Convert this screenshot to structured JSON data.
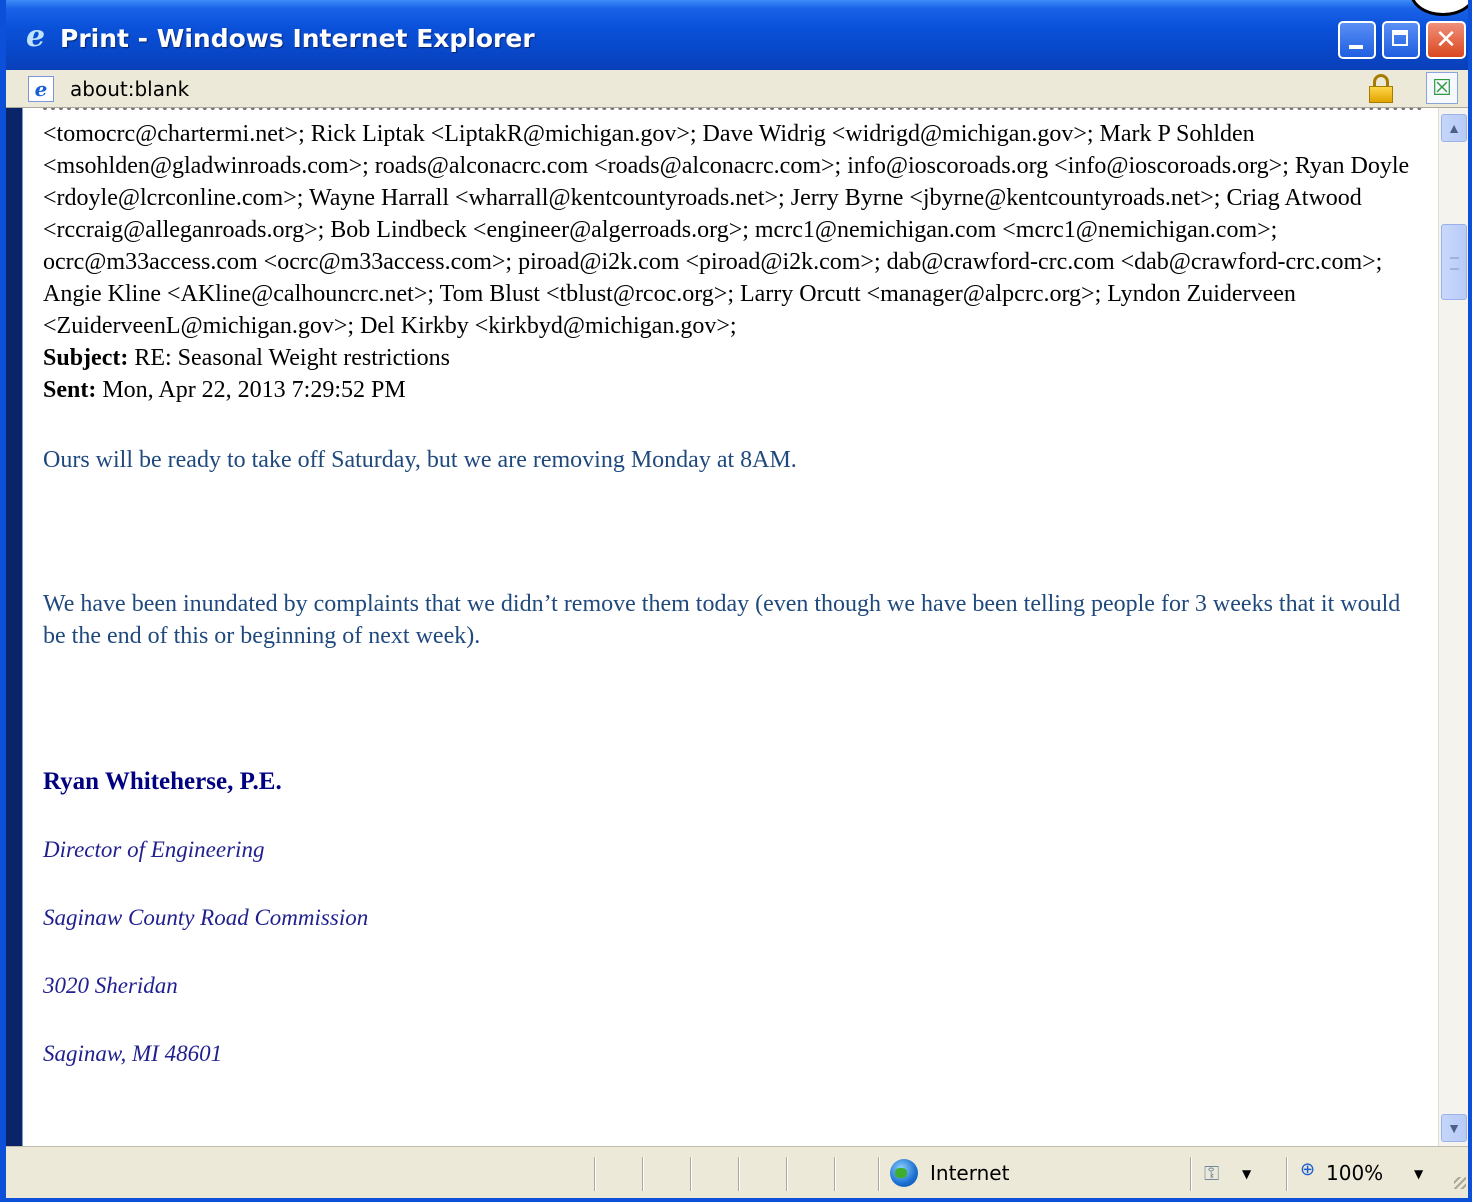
{
  "window": {
    "title": "Print - Windows Internet Explorer",
    "icon": "internet-explorer-icon"
  },
  "address": {
    "url": "about:blank"
  },
  "email": {
    "recipients": "<tomocrc@chartermi.net>; Rick Liptak <LiptakR@michigan.gov>; Dave Widrig <widrigd@michigan.gov>; Mark P Sohlden <msohlden@gladwinroads.com>; roads@alconacrc.com <roads@alconacrc.com>; info@ioscoroads.org <info@ioscoroads.org>; Ryan Doyle <rdoyle@lcrconline.com>; Wayne Harrall <wharrall@kentcountyroads.net>; Jerry Byrne <jbyrne@kentcountyroads.net>; Criag Atwood <rccraig@alleganroads.org>; Bob Lindbeck <engineer@algerroads.org>; mcrc1@nemichigan.com <mcrc1@nemichigan.com>; ocrc@m33access.com <ocrc@m33access.com>; piroad@i2k.com <piroad@i2k.com>; dab@crawford-crc.com <dab@crawford-crc.com>; Angie Kline <AKline@calhouncrc.net>; Tom Blust <tblust@rcoc.org>; Larry Orcutt <manager@alpcrc.org>; Lyndon Zuiderveen <ZuiderveenL@michigan.gov>; Del Kirkby <kirkbyd@michigan.gov>;",
    "subject_label": "Subject:",
    "subject": "RE: Seasonal Weight restrictions",
    "sent_label": "Sent:",
    "sent": "Mon, Apr 22, 2013 7:29:52 PM",
    "body": [
      "Ours will be ready to take off Saturday, but we are removing Monday at 8AM.",
      "We have been inundated by complaints that we didn’t remove them today (even though we have been telling people for 3 weeks that it would be the end of this or beginning of next week)."
    ],
    "signature": {
      "name": "Ryan Whiteherse, P.E.",
      "title": "Director of Engineering",
      "org": "Saginaw County Road Commission",
      "street": "3020 Sheridan",
      "city": "Saginaw, MI 48601"
    }
  },
  "status": {
    "zone": "Internet",
    "zoom": "100%"
  },
  "colors": {
    "titlebar": "#0a51d9",
    "body_text": "#1f497d",
    "signature_name": "#000080"
  }
}
